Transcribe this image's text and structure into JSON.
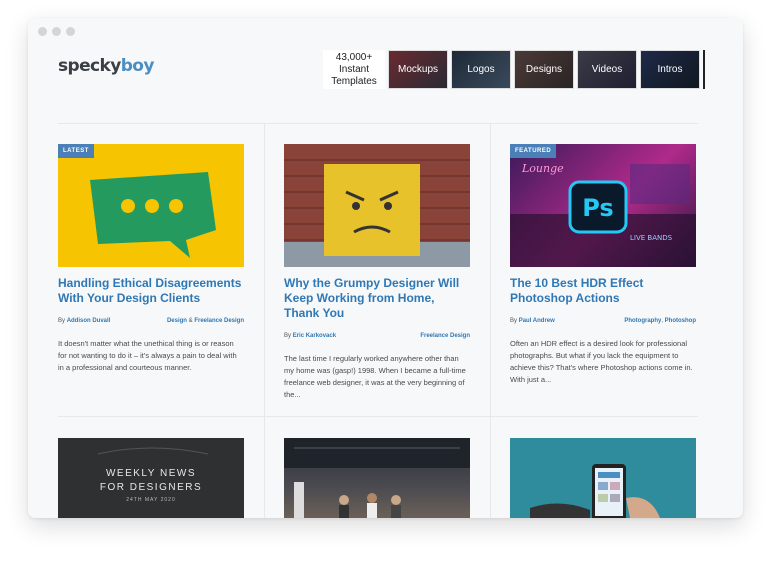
{
  "logo": {
    "part1": "specky",
    "part2": "boy"
  },
  "promo": {
    "count_line1": "43,000+",
    "count_line2": "Instant",
    "count_line3": "Templates",
    "tiles": [
      "Mockups",
      "Logos",
      "Designs",
      "Videos",
      "Intros"
    ]
  },
  "articles": [
    {
      "badge": "LATEST",
      "title": "Handling Ethical Disagreements With Your Design Clients",
      "by": "By",
      "author": "Addison Duvall",
      "cat1": "Design",
      "cat_sep": "&",
      "cat2": "Freelance Design",
      "excerpt": "It doesn't matter what the unethical thing is or reason for not wanting to do it – it's always a pain to deal with in a professional and courteous manner."
    },
    {
      "badge": "",
      "title": "Why the Grumpy Designer Will Keep Working from Home, Thank You",
      "by": "By",
      "author": "Eric Karkovack",
      "cat1": "Freelance Design",
      "excerpt": "The last time I regularly worked anywhere other than my home was (gasp!) 1998. When I became a full-time freelance web designer, it was at the very beginning of the..."
    },
    {
      "badge": "FEATURED",
      "title": "The 10 Best HDR Effect Photoshop Actions",
      "by": "By",
      "author": "Paul Andrew",
      "cat1": "Photography",
      "cat_sep": ",",
      "cat2": "Photoshop",
      "excerpt": "Often an HDR effect is a desired look for professional photographs. But what if you lack the equipment to achieve this? That's where Photoshop actions come in. With just a..."
    }
  ],
  "row2": {
    "news_line1": "WEEKLY NEWS",
    "news_line2": "FOR DESIGNERS",
    "news_date": "24TH MAY 2020"
  },
  "hero_icons": {
    "ps": "Ps",
    "sign": "Lounge",
    "neon": "LIVE BANDS"
  },
  "colors": {
    "accent": "#2f78b5",
    "badge": "#4b7fb8",
    "yellow": "#f6c400",
    "green": "#249a5f"
  }
}
